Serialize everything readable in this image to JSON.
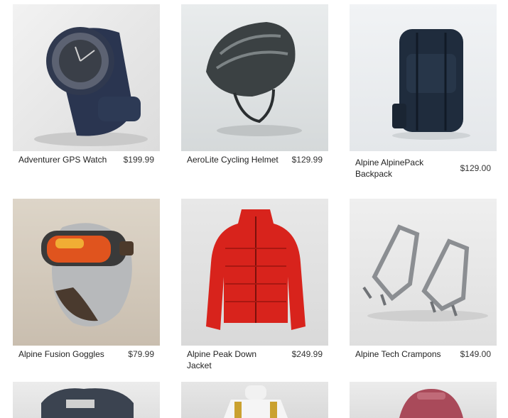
{
  "products": [
    {
      "name": "Adventurer GPS Watch",
      "price": "$199.99",
      "icon": "gps-watch-image"
    },
    {
      "name": "AeroLite Cycling Helmet",
      "price": "$129.99",
      "icon": "cycling-helmet-image"
    },
    {
      "name": "Alpine AlpinePack Backpack",
      "price": "$129.00",
      "icon": "backpack-image"
    },
    {
      "name": "Alpine Fusion Goggles",
      "price": "$79.99",
      "icon": "goggles-image"
    },
    {
      "name": "Alpine Peak Down Jacket",
      "price": "$249.99",
      "icon": "down-jacket-image"
    },
    {
      "name": "Alpine Tech Crampons",
      "price": "$149.00",
      "icon": "crampons-image"
    },
    {
      "name": "",
      "price": "",
      "icon": "harness-image"
    },
    {
      "name": "",
      "price": "",
      "icon": "mannequin-vest-image"
    },
    {
      "name": "",
      "price": "",
      "icon": "pink-gear-image"
    }
  ],
  "colors": {
    "watch": "#2a3550",
    "helmet": "#3b4143",
    "backpack": "#1f2c3d",
    "goggles_lens": "#e0541e",
    "jacket": "#d8231c",
    "crampons": "#8b8e92"
  }
}
